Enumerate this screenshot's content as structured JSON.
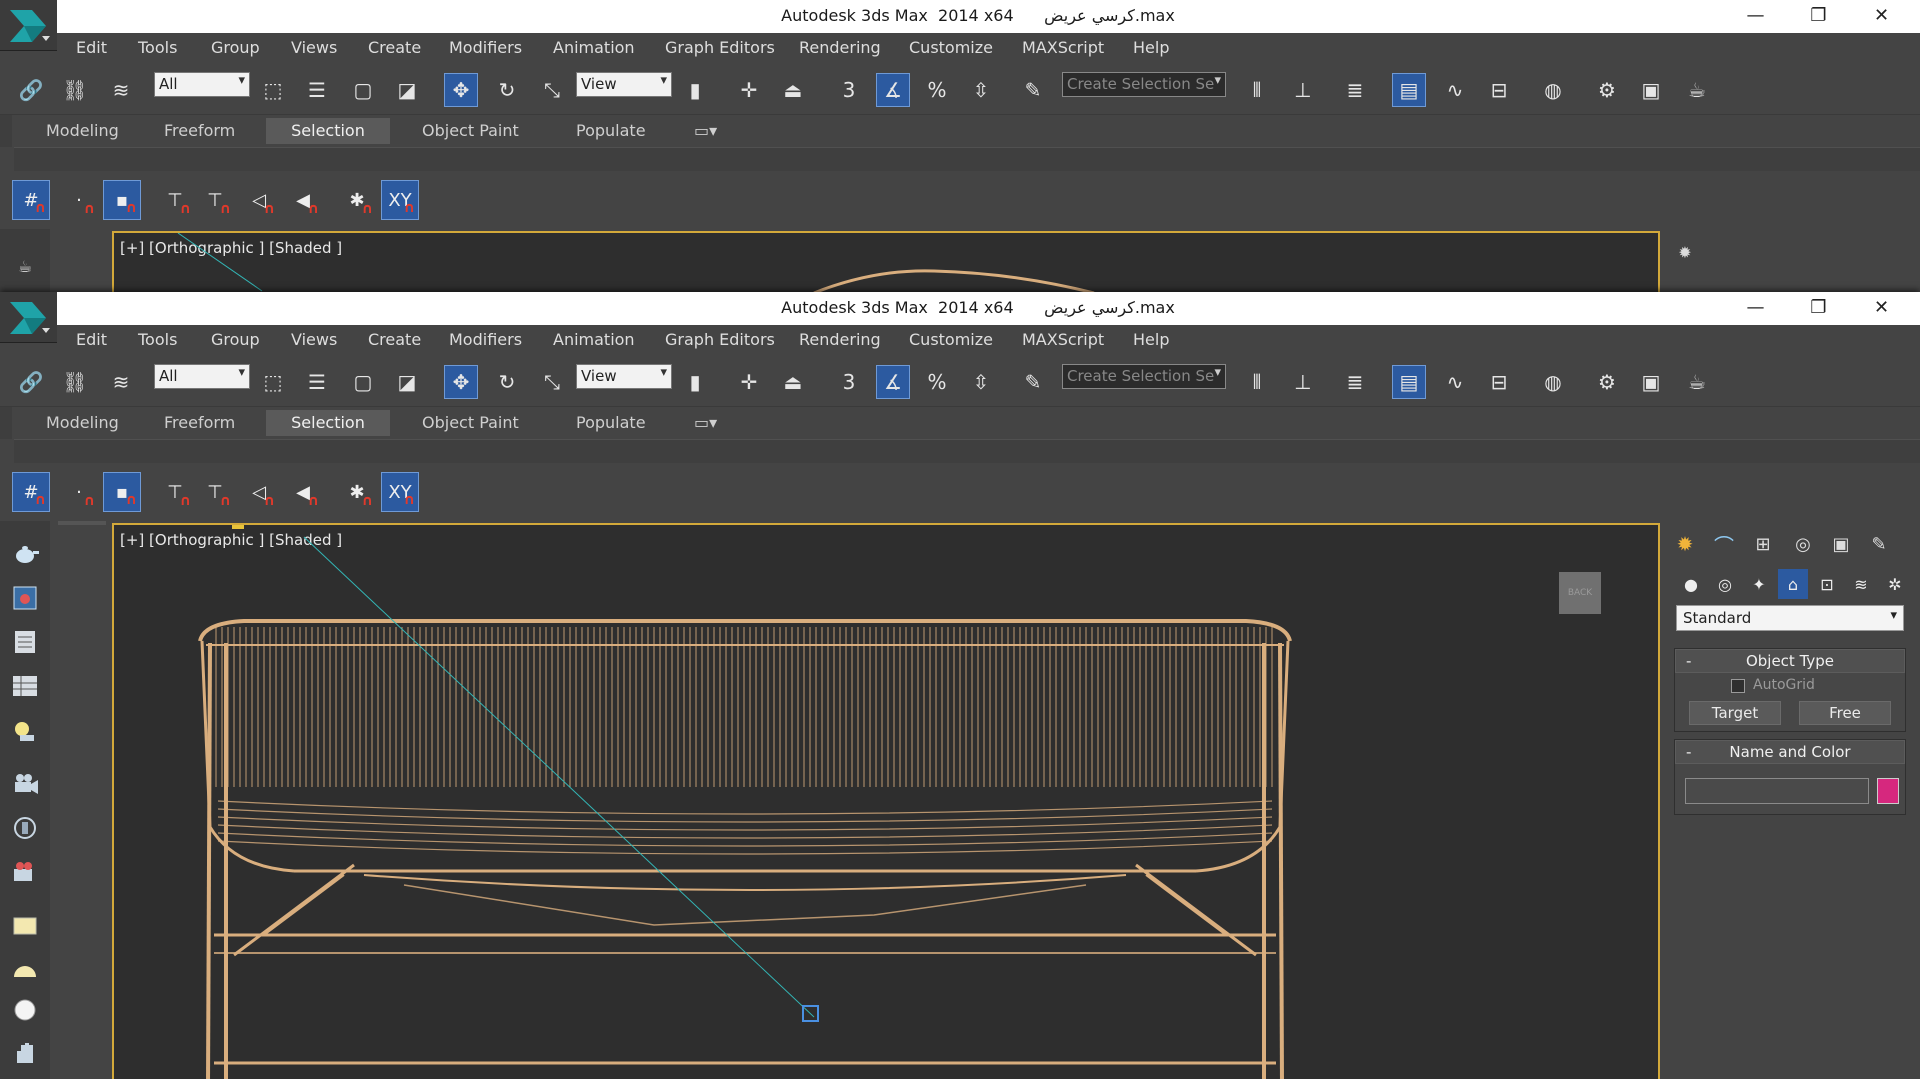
{
  "window": {
    "app_title": "Autodesk 3ds Max  2014 x64",
    "file_name": "كرسي عريض.max",
    "controls": {
      "minimize": "—",
      "restore": "❐",
      "close": "✕"
    }
  },
  "menu": [
    "Edit",
    "Tools",
    "Group",
    "Views",
    "Create",
    "Modifiers",
    "Animation",
    "Graph Editors",
    "Rendering",
    "Customize",
    "MAXScript",
    "Help"
  ],
  "toolbar": {
    "selection_filter": "All",
    "reference_coord": "View",
    "named_selection_placeholder": "Create Selection Se",
    "angle_snap_label": "3",
    "percent_snap_label": "%"
  },
  "ribbon": {
    "tabs": [
      "Modeling",
      "Freeform",
      "Selection",
      "Object Paint",
      "Populate"
    ],
    "selected_tab": "Selection"
  },
  "snaps": {
    "xy_label": "XY"
  },
  "viewport": {
    "label": "[+] [Orthographic ] [Shaded ]",
    "viewcube_face": "BACK",
    "wire_color": "#d9ae7e",
    "background_color": "#2e2e2e"
  },
  "command_panel": {
    "category": "Standard",
    "object_type": {
      "title": "Object Type",
      "autogrid_label": "AutoGrid",
      "autogrid_checked": false,
      "buttons": [
        "Target",
        "Free"
      ]
    },
    "name_and_color": {
      "title": "Name and Color",
      "name_value": "",
      "color": "#d6287e"
    }
  },
  "colors": {
    "accent": "#2c5aa0",
    "viewport_border": "#d3a93a"
  }
}
